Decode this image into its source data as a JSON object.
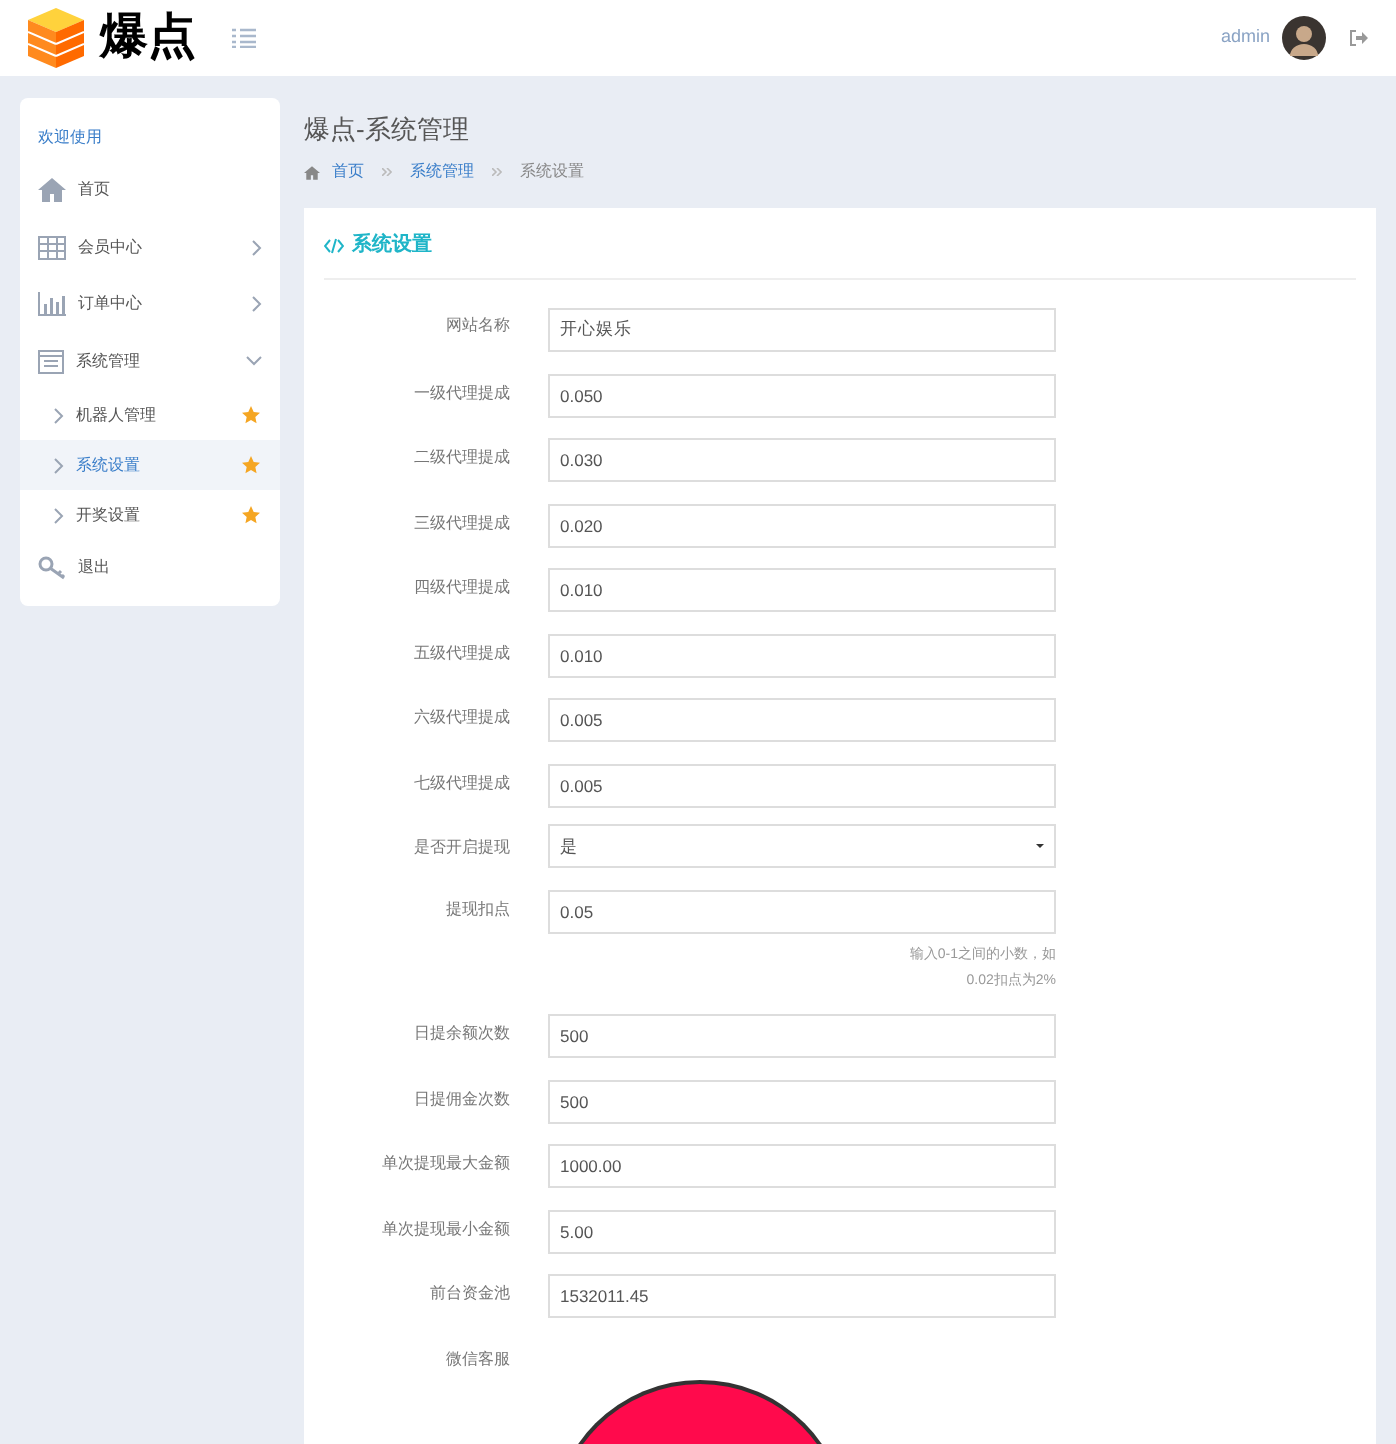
{
  "header": {
    "logo_text": "爆点",
    "user": "admin"
  },
  "sidebar": {
    "heading": "欢迎使用",
    "items": [
      {
        "label": "首页",
        "kind": "home"
      },
      {
        "label": "会员中心",
        "kind": "grid",
        "expanded": false
      },
      {
        "label": "订单中心",
        "kind": "chart",
        "expanded": false
      },
      {
        "label": "系统管理",
        "kind": "window",
        "expanded": true,
        "children": [
          {
            "label": "机器人管理",
            "selected": false
          },
          {
            "label": "系统设置",
            "selected": true
          },
          {
            "label": "开奖设置",
            "selected": false
          }
        ]
      },
      {
        "label": "退出",
        "kind": "key"
      }
    ]
  },
  "page": {
    "title": "爆点-系统管理",
    "breadcrumb": [
      "首页",
      "系统管理",
      "系统设置"
    ]
  },
  "card": {
    "title": "系统设置",
    "fields": [
      {
        "label": "网站名称",
        "kind": "input",
        "value": "开心娱乐"
      },
      {
        "label": "一级代理提成",
        "kind": "input",
        "value": "0.050"
      },
      {
        "label": "二级代理提成",
        "kind": "input",
        "value": "0.030"
      },
      {
        "label": "三级代理提成",
        "kind": "input",
        "value": "0.020"
      },
      {
        "label": "四级代理提成",
        "kind": "input",
        "value": "0.010"
      },
      {
        "label": "五级代理提成",
        "kind": "input",
        "value": "0.010"
      },
      {
        "label": "六级代理提成",
        "kind": "input",
        "value": "0.005"
      },
      {
        "label": "七级代理提成",
        "kind": "input",
        "value": "0.005"
      },
      {
        "label": "是否开启提现",
        "kind": "select",
        "value": "是"
      },
      {
        "label": "提现扣点",
        "kind": "input",
        "value": "0.05",
        "help": "输入0-1之间的小数，如0.02扣点为2%"
      },
      {
        "label": "日提余额次数",
        "kind": "input",
        "value": "500"
      },
      {
        "label": "日提佣金次数",
        "kind": "input",
        "value": "500"
      },
      {
        "label": "单次提现最大金额",
        "kind": "input",
        "value": "1000.00"
      },
      {
        "label": "单次提现最小金额",
        "kind": "input",
        "value": "5.00"
      },
      {
        "label": "前台资金池",
        "kind": "input",
        "value": "1532011.45"
      },
      {
        "label": "微信客服",
        "kind": "picture"
      }
    ]
  }
}
